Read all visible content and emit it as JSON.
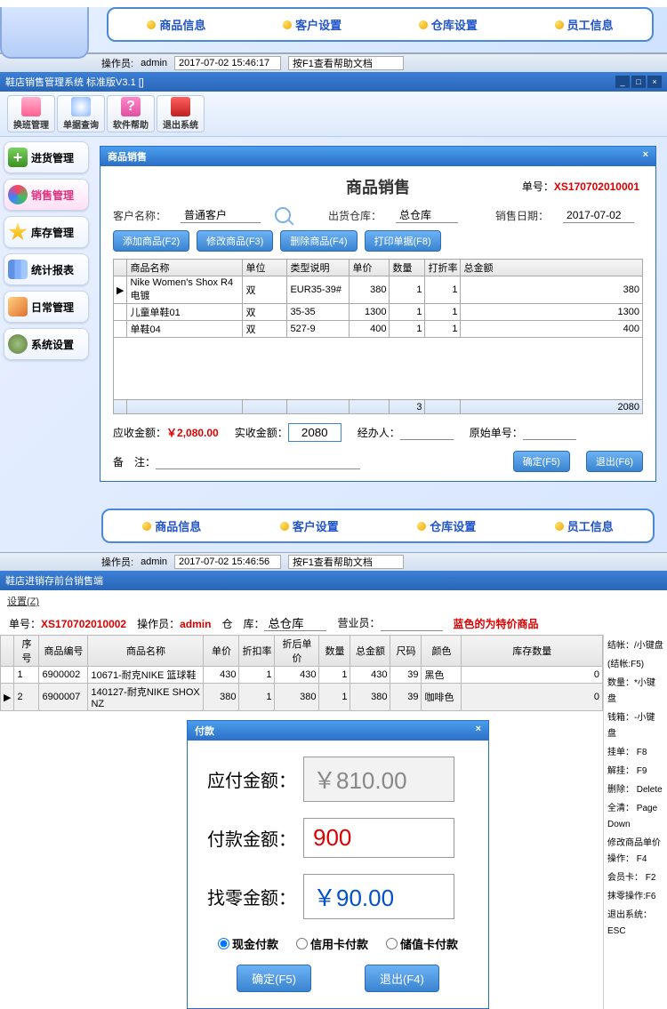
{
  "nav": {
    "product_info": "商品信息",
    "customer_setup": "客户设置",
    "warehouse_setup": "仓库设置",
    "staff_info": "员工信息"
  },
  "status1": {
    "operator_label": "操作员:",
    "operator": "admin",
    "datetime": "2017-07-02 15:46:17",
    "help_hint": "按F1查看帮助文档"
  },
  "app2_title": "鞋店销售管理系统 标准版V3.1 []",
  "toolbar": {
    "shift": "换班管理",
    "query": "单据查询",
    "help": "软件帮助",
    "exit": "退出系统"
  },
  "sidebar": {
    "purchase": "进货管理",
    "sales": "销售管理",
    "stock": "库存管理",
    "stats": "统计报表",
    "daily": "日常管理",
    "settings": "系统设置"
  },
  "sales_dlg": {
    "title": "商品销售",
    "heading": "商品销售",
    "order_no_label": "单号：",
    "order_no": "XS170702010001",
    "customer_label": "客户名称：",
    "customer": "普通客户",
    "warehouse_label": "出货仓库：",
    "warehouse": "总仓库",
    "date_label": "销售日期：",
    "date": "2017-07-02",
    "btn_add": "添加商品(F2)",
    "btn_edit": "修改商品(F3)",
    "btn_del": "删除商品(F4)",
    "btn_print": "打印单据(F8)",
    "cols": {
      "name": "商品名称",
      "unit": "单位",
      "spec": "类型说明",
      "price": "单价",
      "qty": "数量",
      "discount": "打折率",
      "total": "总金额"
    },
    "rows": [
      {
        "name": "Nike Women's Shox R4 电镀",
        "unit": "双",
        "spec": "EUR35-39#",
        "price": 380,
        "qty": 1,
        "discount": 1,
        "total": 380
      },
      {
        "name": "儿童单鞋01",
        "unit": "双",
        "spec": "35-35",
        "price": 1300,
        "qty": 1,
        "discount": 1,
        "total": 1300
      },
      {
        "name": "单鞋04",
        "unit": "双",
        "spec": "527-9",
        "price": 400,
        "qty": 1,
        "discount": 1,
        "total": 400
      }
    ],
    "sum_qty": 3,
    "sum_total": 2080,
    "due_label": "应收金额：",
    "due": "￥2,080.00",
    "actual_label": "实收金额：",
    "actual": "2080",
    "handler_label": "经办人：",
    "orig_no_label": "原始单号：",
    "remark_label": "备　注：",
    "btn_ok": "确定(F5)",
    "btn_exit": "退出(F6)"
  },
  "status2": {
    "operator_label": "操作员:",
    "operator": "admin",
    "datetime": "2017-07-02 15:46:56",
    "help_hint": "按F1查看帮助文档"
  },
  "sec3_title": "鞋店进销存前台销售端",
  "settings_menu": "设置(Z)",
  "pos": {
    "order_label": "单号：",
    "order": "XS170702010002",
    "op_label": "操作员：",
    "op": "admin",
    "wh_label": "仓　库：",
    "wh": "总仓库",
    "sales_label": "营业员：",
    "blue_hint": "蓝色的为特价商品",
    "cols": {
      "seq": "序号",
      "code": "商品编号",
      "name": "商品名称",
      "price": "单价",
      "discount": "折扣率",
      "after": "折后单价",
      "qty": "数量",
      "total": "总金额",
      "size": "尺码",
      "color": "颜色",
      "stock": "库存数量"
    },
    "rows": [
      {
        "seq": 1,
        "code": "6900002",
        "name": "10671-耐克NIKE 篮球鞋",
        "price": 430,
        "discount": 1,
        "after": 430,
        "qty": 1,
        "total": 430,
        "size": 39,
        "color": "黑色",
        "stock": 0
      },
      {
        "seq": 2,
        "code": "6900007",
        "name": "140127-耐克NIKE SHOX NZ",
        "price": 380,
        "discount": 1,
        "after": 380,
        "qty": 1,
        "total": 380,
        "size": 39,
        "color": "咖啡色",
        "stock": 0
      }
    ]
  },
  "shortcuts": {
    "checkout": "结帐：/小键盘",
    "checkout2": "(结帐:F5)",
    "qty": "数量：*小键盘",
    "cash": "钱箱：-小键盘",
    "hold": "挂单：  F8",
    "unhold": "解挂：  F9",
    "del": "删除：  Delete",
    "full": "全清：  Page Down",
    "edit": "修改商品单价操作：  F4",
    "member": "会员卡：  F2",
    "wipe": "抹零操作:F6",
    "exit": "退出系统：  ESC"
  },
  "pay": {
    "title": "付款",
    "due_label": "应付金额：",
    "due": "￥810.00",
    "paid_label": "付款金额：",
    "paid": "900",
    "change_label": "找零金额：",
    "change": "￥90.00",
    "cash": "现金付款",
    "credit": "信用卡付款",
    "stored": "储值卡付款",
    "ok": "确定(F5)",
    "exit": "退出(F4)"
  }
}
